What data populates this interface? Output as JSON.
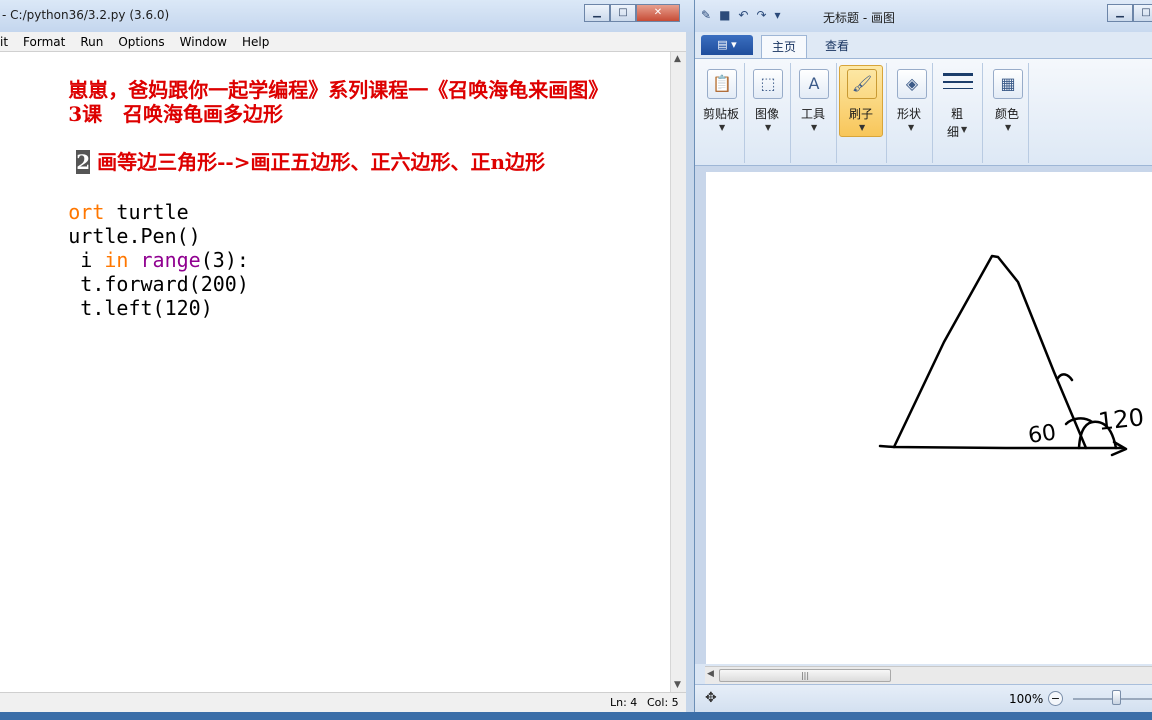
{
  "idle": {
    "title": "- C:/python36/3.2.py (3.6.0)",
    "menu": [
      "it",
      "Format",
      "Run",
      "Options",
      "Window",
      "Help"
    ],
    "lines": {
      "l1": "崽崽，爸妈跟你一起学编程》系列课程一《召唤海龟来画图》",
      "l2": "3课   召唤海龟画多边形",
      "l3_num": "2",
      "l3_text": " 画等边三角形-->画正五边形、正六边形、正n边形",
      "l4_kw": "ort",
      "l4_rest": " turtle",
      "l5": "urtle.Pen()",
      "l6_a": " i ",
      "l6_kw": "in",
      "l6_bi": "range",
      "l6_rest": "(3):",
      "l7": " t.forward(200)",
      "l8": " t.left(120)"
    },
    "status": {
      "ln": "Ln: 4",
      "col": "Col: 5"
    }
  },
  "paint": {
    "title": "无标题 - 画图",
    "tabs": {
      "home": "主页",
      "view": "查看"
    },
    "groups": {
      "clipboard": "剪贴板",
      "image": "图像",
      "tools": "工具",
      "brush": "刷子",
      "shapes": "形状",
      "size_top": "粗",
      "size_bottom": "细",
      "colors": "颜色"
    },
    "drawing_text": {
      "angle1": "60",
      "angle2": "120"
    },
    "zoom": "100%"
  },
  "colors": {
    "comment": "#dd0000",
    "keyword": "#ff7700",
    "builtin": "#900090",
    "ribbon_selected": "#f8c65a"
  },
  "icons": [
    "paint-app-icon",
    "save-icon",
    "undo-icon",
    "redo-icon",
    "clipboard-icon",
    "select-icon",
    "tools-icon",
    "brush-icon",
    "shapes-icon",
    "size-icon",
    "colors-icon",
    "move-icon"
  ]
}
